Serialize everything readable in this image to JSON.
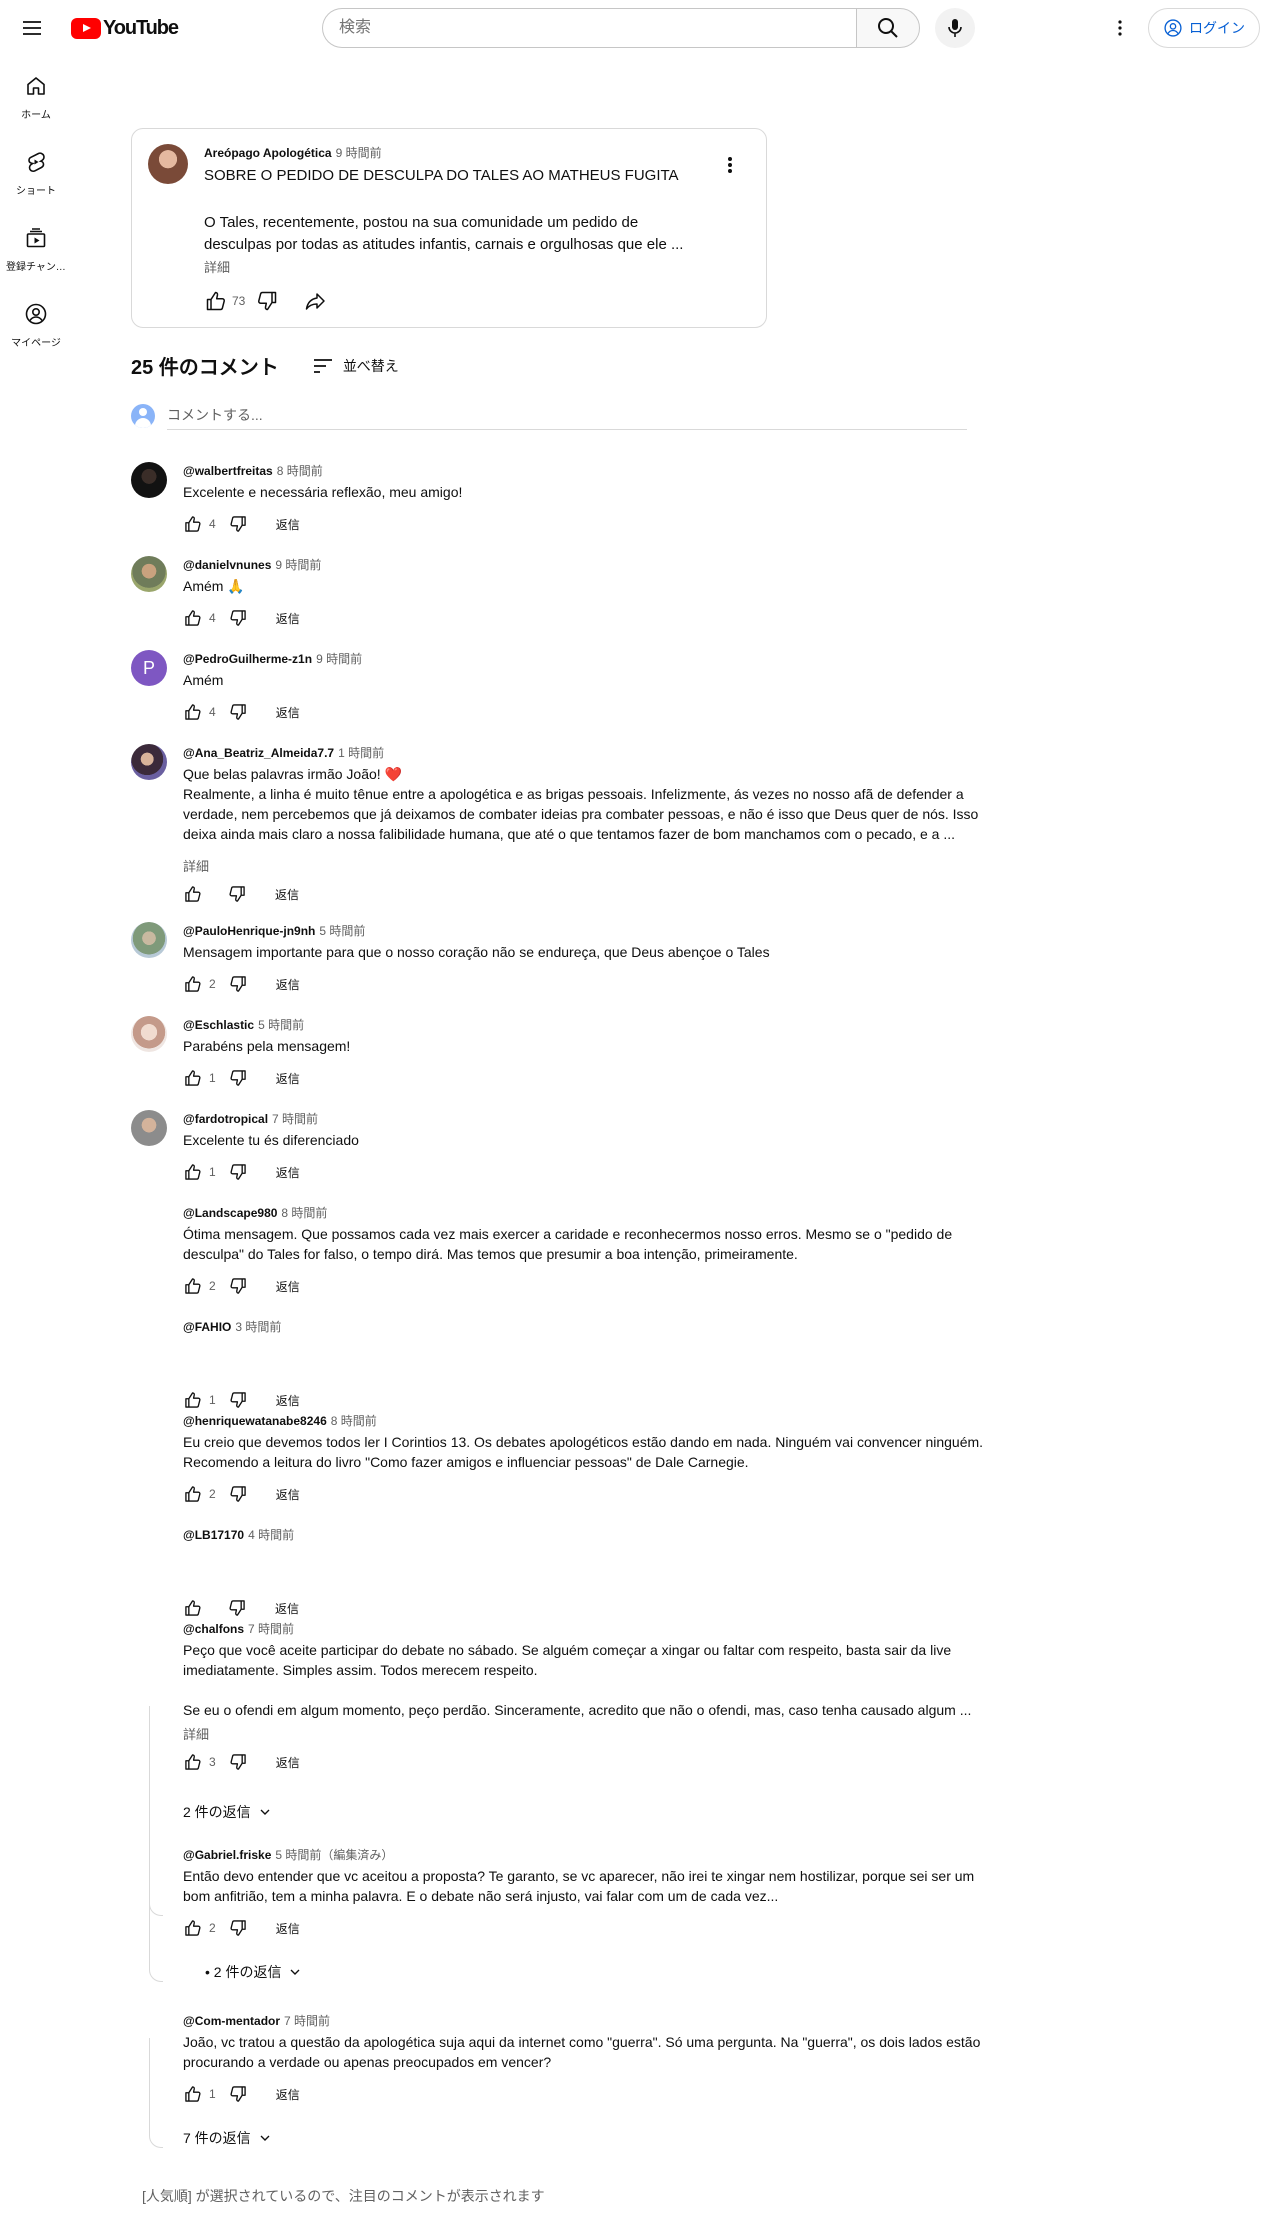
{
  "header": {
    "logo_text": "YouTube",
    "search_placeholder": "検索",
    "login_label": "ログイン"
  },
  "guide": [
    {
      "label": "ホーム",
      "icon": "home-icon"
    },
    {
      "label": "ショート",
      "icon": "shorts-icon"
    },
    {
      "label": "登録チャンネル",
      "icon": "subscriptions-icon"
    },
    {
      "label": "マイページ",
      "icon": "you-icon"
    }
  ],
  "post": {
    "author": "Areópago Apologética",
    "time": "9 時間前",
    "title": "SOBRE O PEDIDO DE DESCULPA DO TALES AO MATHEUS FUGITA",
    "body": "O Tales, recentemente, postou na sua comunidade um pedido de desculpas por todas as atitudes infantis, carnais e orgulhosas que ele ...",
    "more_label": "詳細",
    "likes": "73"
  },
  "comments_header": {
    "count_label": "25 件のコメント",
    "sort_label": "並べ替え",
    "add_placeholder": "コメントする..."
  },
  "reply_label": "返信",
  "comments": [
    {
      "author": "@walbertfreitas",
      "time": "8 時間前",
      "text": "Excelente e necessária reflexão, meu amigo!",
      "likes": "4"
    },
    {
      "author": "@danielvnunes",
      "time": "9 時間前",
      "text": "Amém 🙏",
      "likes": "4"
    },
    {
      "author": "@PedroGuilherme-z1n",
      "time": "9 時間前",
      "text": "Amém",
      "likes": "4",
      "initial": "P"
    },
    {
      "author": "@Ana_Beatriz_Almeida7.7",
      "time": "1 時間前",
      "text": "Que belas palavras irmão João! ❤️\nRealmente, a linha é muito tênue entre a apologética e as brigas pessoais. Infelizmente, ás vezes no nosso afã de defender a verdade, nem percebemos que já deixamos de combater ideias pra combater pessoas, e não é isso que Deus quer de nós. Isso deixa ainda mais claro a nossa falibilidade humana, que até o que tentamos fazer de bom manchamos com o pecado, e  a ...",
      "likes": "",
      "more": "詳細"
    },
    {
      "author": "@PauloHenrique-jn9nh",
      "time": "5 時間前",
      "text": "Mensagem importante para que o nosso coração não se endureça, que Deus abençoe o Tales",
      "likes": "2"
    },
    {
      "author": "@Eschlastic",
      "time": "5 時間前",
      "text": "Parabéns pela mensagem!",
      "likes": "1"
    },
    {
      "author": "@fardotropical",
      "time": "7 時間前",
      "text": "Excelente       tu és diferenciado",
      "likes": "1"
    },
    {
      "author": "@Landscape980",
      "time": "8 時間前",
      "text": "Ótima mensagem. Que possamos cada vez mais exercer a caridade e reconhecermos nosso erros. Mesmo se o \"pedido de desculpa\" do Tales for falso, o tempo dirá. Mas temos que presumir a boa intenção, primeiramente.",
      "likes": "2"
    },
    {
      "author": "@FAHIO",
      "time": "3 時間前",
      "text": "",
      "likes": "1"
    },
    {
      "author": "@henriquewatanabe8246",
      "time": "8 時間前",
      "text": "Eu creio que devemos todos ler I Corintios 13. Os debates apologéticos estão dando em nada. Ninguém vai convencer ninguém. Recomendo a leitura do livro \"Como fazer amigos e influenciar pessoas\" de Dale Carnegie.",
      "likes": "2"
    },
    {
      "author": "@LB17170",
      "time": "4 時間前",
      "text": "",
      "likes": ""
    },
    {
      "author": "@chalfons",
      "time": "7 時間前",
      "text": "Peço que você aceite participar do debate no sábado. Se alguém começar a xingar ou faltar com respeito, basta sair da live imediatamente. Simples assim. Todos merecem respeito.\n\nSe eu o ofendi em algum momento, peço perdão. Sinceramente, acredito que não o ofendi, mas, caso tenha causado algum ...",
      "likes": "3",
      "more": "詳細",
      "replies": "2 件の返信"
    },
    {
      "author": "@Gabriel.friske",
      "time": "5 時間前（編集済み）",
      "text": "Então devo entender que vc aceitou a proposta? Te garanto, se vc aparecer, não irei te xingar nem hostilizar, porque sei ser um bom anfitrião, tem a minha palavra. E o debate não será injusto, vai falar com um de cada vez...",
      "likes": "2",
      "replies": "• 2 件の返信"
    },
    {
      "author": "@Com-mentador",
      "time": "7 時間前",
      "text": "João, vc tratou a questão da apologética suja aqui da internet como \"guerra\". Só uma pergunta. Na \"guerra\", os dois lados estão procurando a verdade ou apenas preocupados  em vencer?",
      "likes": "1",
      "replies": "7 件の返信"
    }
  ],
  "footer_note": "[人気順] が選択されているので、注目のコメントが表示されます",
  "colors": {
    "brand": "#ff0000",
    "link": "#065fd4",
    "secondary_text": "#606060",
    "pedro_avatar": "#7e57c2"
  }
}
